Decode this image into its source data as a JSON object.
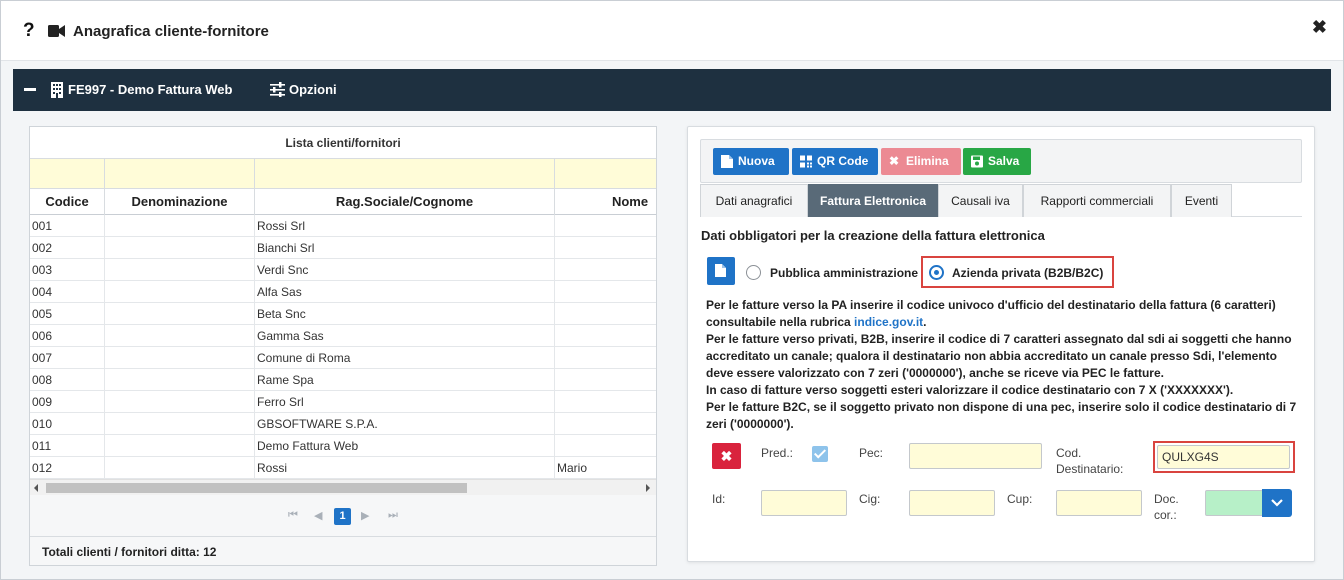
{
  "window": {
    "title": "Anagrafica cliente-fornitore",
    "help_glyph": "?",
    "close_glyph": "✖"
  },
  "navbar": {
    "company": "FE997 - Demo Fattura Web",
    "options_label": "Opzioni"
  },
  "grid": {
    "caption": "Lista clienti/fornitori",
    "columns": [
      "Codice",
      "Denominazione",
      "Rag.Sociale/Cognome",
      "Nome"
    ],
    "rows": [
      [
        "001",
        "",
        "Rossi Srl",
        ""
      ],
      [
        "002",
        "",
        "Bianchi Srl",
        ""
      ],
      [
        "003",
        "",
        "Verdi Snc",
        ""
      ],
      [
        "004",
        "",
        "Alfa Sas",
        ""
      ],
      [
        "005",
        "",
        "Beta Snc",
        ""
      ],
      [
        "006",
        "",
        "Gamma Sas",
        ""
      ],
      [
        "007",
        "",
        "Comune di Roma",
        ""
      ],
      [
        "008",
        "",
        "Rame Spa",
        ""
      ],
      [
        "009",
        "",
        "Ferro Srl",
        ""
      ],
      [
        "010",
        "",
        "GBSOFTWARE S.P.A.",
        ""
      ],
      [
        "011",
        "",
        "Demo Fattura Web",
        ""
      ],
      [
        "012",
        "",
        "Rossi",
        "Mario"
      ]
    ],
    "current_page": "1",
    "totals": "Totali clienti / fornitori ditta: 12"
  },
  "toolbar": {
    "new_label": "Nuova",
    "qr_label": "QR Code",
    "delete_label": "Elimina",
    "save_label": "Salva"
  },
  "tabs": [
    "Dati anagrafici",
    "Fattura Elettronica",
    "Causali iva",
    "Rapporti commerciali",
    "Eventi"
  ],
  "fe": {
    "section_title": "Dati obbligatori per la creazione della fattura elettronica",
    "radio_pa": "Pubblica amministrazione",
    "radio_private": "Azienda privata (B2B/B2C)",
    "info_1": "Per le fatture verso la PA inserire il codice univoco d'ufficio del destinatario della fattura (6 caratteri)",
    "info_2a": "consultabile nella rubrica ",
    "info_2_link": "indice.gov.it",
    "info_2b": ".",
    "info_3": "Per le fatture verso privati, B2B, inserire il codice di 7 caratteri assegnato dal sdi ai soggetti che hanno",
    "info_4": "accreditato un canale; qualora il destinatario non abbia accreditato un canale presso Sdi, l'elemento",
    "info_5": "deve essere valorizzato con 7 zeri ('0000000'), anche se riceve via PEC le fatture.",
    "info_6": "In caso di fatture verso soggetti esteri valorizzare il codice destinatario con 7 X ('XXXXXXX').",
    "info_7": "Per le fatture B2C, se il soggetto privato non dispone di una pec, inserire solo il codice destinatario di 7",
    "info_8": "zeri ('0000000').",
    "labels": {
      "pred": "Pred.:",
      "pec": "Pec:",
      "cod_dest_1": "Cod.",
      "cod_dest_2": "Destinatario:",
      "id": "Id:",
      "cig": "Cig:",
      "cup": "Cup:",
      "doc_cor_1": "Doc.",
      "doc_cor_2": "cor.:"
    },
    "values": {
      "pec": "",
      "cod_dest": "QULXG4S",
      "id": "",
      "cig": "",
      "cup": ""
    },
    "delete_glyph": "✖"
  },
  "colors": {
    "navbar": "#1e3040",
    "primary": "#1f73c7",
    "danger": "#d9233d",
    "success": "#28a745",
    "delete_disabled": "#ec8a93",
    "tab_active": "#596a78",
    "input_bg": "#fffcd8",
    "highlight": "#d9443f"
  }
}
